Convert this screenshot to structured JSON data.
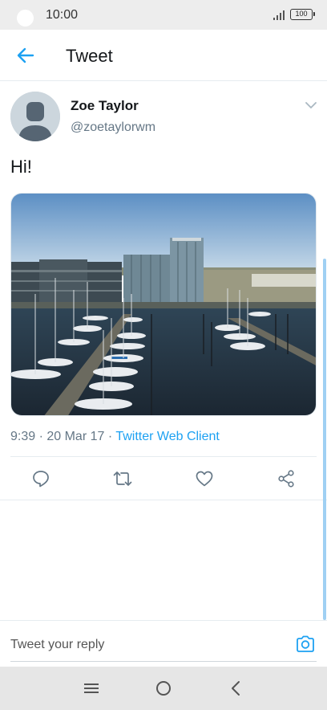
{
  "status_bar": {
    "time": "10:00",
    "battery": "100",
    "icons": [
      "signal-icon",
      "battery-icon"
    ]
  },
  "header": {
    "title": "Tweet",
    "back_icon": "arrow-left-icon"
  },
  "tweet": {
    "author_name": "Zoe Taylor",
    "author_handle": "@zoetaylorwm",
    "text": "Hi!",
    "media": "photo of a harbour marina with boats and office buildings",
    "timestamp": "9:39 · 20 Mar 17 · ",
    "client": "Twitter Web Client",
    "menu_icon": "chevron-down-icon"
  },
  "actions": [
    {
      "name": "reply",
      "icon": "comment-icon"
    },
    {
      "name": "retweet",
      "icon": "retweet-icon"
    },
    {
      "name": "like",
      "icon": "heart-icon"
    },
    {
      "name": "share",
      "icon": "share-icon"
    }
  ],
  "reply": {
    "placeholder": "Tweet your reply",
    "camera_icon": "camera-icon"
  },
  "nav": {
    "icons": [
      "menu-icon",
      "home-icon",
      "back-icon"
    ]
  },
  "colors": {
    "accent": "#1da1f2",
    "text": "#14171a",
    "secondary": "#657786"
  }
}
